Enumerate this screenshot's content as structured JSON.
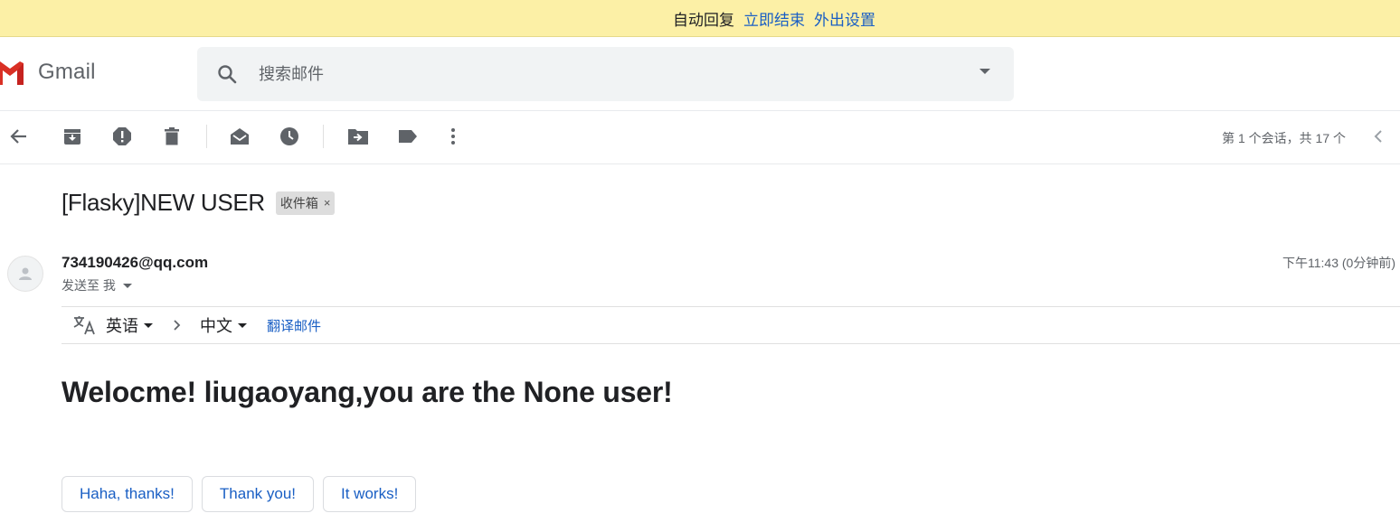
{
  "banner": {
    "text": "自动回复",
    "end_now": "立即结束",
    "out_of_office_settings": "外出设置"
  },
  "header": {
    "logo_text": "Gmail",
    "search_placeholder": "搜索邮件"
  },
  "toolbar": {
    "pager_text": "第 1 个会话，共 17 个"
  },
  "message": {
    "subject": "[Flasky]NEW USER",
    "label": "收件箱",
    "label_remove": "×",
    "sender": "734190426@qq.com",
    "sent_to": "发送至 我",
    "timestamp": "下午11:43 (0分钟前)"
  },
  "translate": {
    "from_lang": "英语",
    "to_lang": "中文",
    "action": "翻译邮件"
  },
  "body": {
    "text": "Welocme! liugaoyang,you are the None user!"
  },
  "smart_replies": [
    "Haha, thanks!",
    "Thank you!",
    "It works!"
  ],
  "colors": {
    "banner_bg": "#fcf0a6",
    "link_blue": "#1a5fc4",
    "icon_gray": "#5f6368"
  }
}
